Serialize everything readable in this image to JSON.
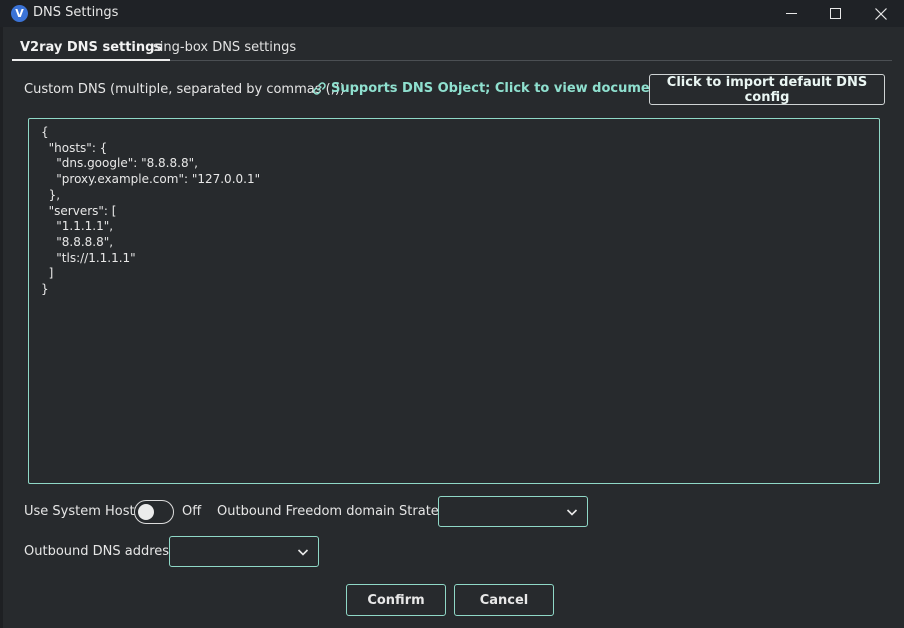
{
  "window": {
    "title": "DNS Settings",
    "app_icon_letter": "V"
  },
  "tabs": [
    {
      "label": "V2ray DNS settings",
      "active": true
    },
    {
      "label": "sing-box DNS settings",
      "active": false
    }
  ],
  "custom_dns": {
    "label": "Custom DNS (multiple, separated by commas (,))",
    "doc_link": "Supports DNS Object; Click to view documentation",
    "import_button": "Click to import default DNS config",
    "value": "{\n  \"hosts\": {\n    \"dns.google\": \"8.8.8.8\",\n    \"proxy.example.com\": \"127.0.0.1\"\n  },\n  \"servers\": [\n    \"1.1.1.1\",\n    \"8.8.8.8\",\n    \"tls://1.1.1.1\"\n  ]\n}"
  },
  "system_hosts": {
    "label": "Use System Hosts",
    "state": "Off"
  },
  "freedom_strategy": {
    "label": "Outbound Freedom domain Strategy",
    "value": ""
  },
  "outbound_dns": {
    "label": "Outbound DNS address",
    "value": ""
  },
  "actions": {
    "confirm": "Confirm",
    "cancel": "Cancel"
  },
  "colors": {
    "accent": "#8fd8c7",
    "background": "#272a2d",
    "titlebar": "#1f2226"
  },
  "icons": {
    "app": "v2rayn-logo-icon",
    "minimize": "minimize-icon",
    "maximize": "maximize-icon",
    "close": "close-icon",
    "link": "link-icon",
    "dropdown": "chevron-down-icon"
  }
}
